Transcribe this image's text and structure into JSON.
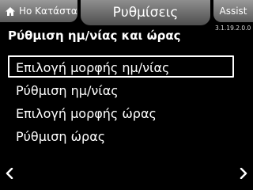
{
  "header": {
    "home_tab_label": "Ho Κατάστα",
    "title": "Ρυθμίσεις",
    "assist_label": "Assist",
    "version": "3.1.19.2.0.0"
  },
  "page": {
    "subtitle": "Ρύθμιση ημ/νίας και ώρας"
  },
  "menu": {
    "items": [
      {
        "label": "Επιλογή μορφής ημ/νίας",
        "selected": true
      },
      {
        "label": "Ρύθμιση ημ/νίας",
        "selected": false
      },
      {
        "label": "Επιλογή μορφής ώρας",
        "selected": false
      },
      {
        "label": "Ρύθμιση ώρας",
        "selected": false
      }
    ]
  },
  "icons": {
    "home": "home-icon",
    "prev": "chevron-left-icon",
    "next": "chevron-right-icon"
  }
}
